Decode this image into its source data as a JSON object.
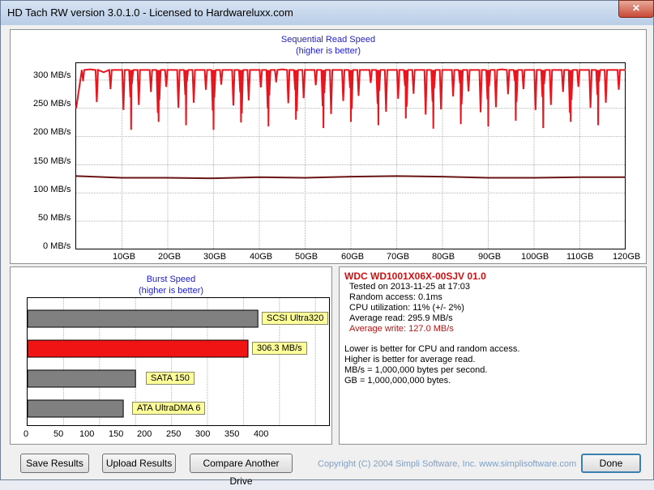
{
  "window": {
    "title": "HD Tach RW version 3.0.1.0 - Licensed to Hardwareluxx.com",
    "close_glyph": "✕"
  },
  "seq_chart": {
    "title": "Sequential Read Speed",
    "subtitle": "(higher is better)",
    "y_ticks": [
      "300 MB/s",
      "250 MB/s",
      "200 MB/s",
      "150 MB/s",
      "100 MB/s",
      "50 MB/s",
      "0 MB/s"
    ],
    "x_ticks": [
      "10GB",
      "20GB",
      "30GB",
      "40GB",
      "50GB",
      "60GB",
      "70GB",
      "80GB",
      "90GB",
      "100GB",
      "110GB",
      "120GB"
    ]
  },
  "burst_chart": {
    "title": "Burst Speed",
    "subtitle": "(higher is better)",
    "x_ticks": [
      "0",
      "50",
      "100",
      "150",
      "200",
      "250",
      "300",
      "350",
      "400"
    ]
  },
  "chart_data": [
    {
      "type": "line",
      "title": "Sequential Read Speed",
      "subtitle": "(higher is better)",
      "x_unit": "GB",
      "xlim": [
        0,
        120
      ],
      "ylim": [
        0,
        330
      ],
      "grid": true,
      "series": [
        {
          "color": "#e8141e",
          "baseline": 318,
          "dip_min": 210,
          "x": [
            0,
            3,
            6,
            9,
            12,
            15,
            18,
            21,
            24,
            27,
            30,
            33,
            36,
            39,
            42,
            45,
            48,
            51,
            54,
            57,
            60,
            63,
            66,
            69,
            72,
            75,
            78,
            81,
            84,
            87,
            90,
            93,
            96,
            99,
            102,
            105,
            108,
            111,
            114,
            117,
            120
          ],
          "y": [
            250,
            319,
            314,
            318,
            212,
            318,
            226,
            318,
            220,
            318,
            212,
            318,
            225,
            318,
            218,
            319,
            230,
            318,
            215,
            318,
            226,
            318,
            220,
            318,
            232,
            318,
            214,
            318,
            222,
            318,
            218,
            319,
            228,
            318,
            215,
            318,
            226,
            318,
            220,
            318,
            318
          ]
        },
        {
          "color": "#6b1414",
          "x": [
            0,
            10,
            20,
            30,
            40,
            50,
            60,
            70,
            80,
            90,
            100,
            110,
            120
          ],
          "y": [
            130,
            127,
            127,
            126,
            128,
            127,
            129,
            130,
            129,
            127,
            127,
            128,
            128
          ]
        }
      ]
    },
    {
      "type": "bar",
      "title": "Burst Speed",
      "subtitle": "(higher is better)",
      "xlim": [
        0,
        420
      ],
      "grid": true,
      "categories": [
        "SCSI Ultra320",
        "306.3 MB/s",
        "SATA 150",
        "ATA UltraDMA 6"
      ],
      "values": [
        320,
        306.3,
        150,
        133
      ],
      "colors": [
        "#808080",
        "#f01414",
        "#808080",
        "#808080"
      ]
    }
  ],
  "info": {
    "drive_title": "WDC WD1001X06X-00SJV 01.0",
    "tested_on": "Tested on 2013-11-25 at 17:03",
    "random_access": "Random access: 0.1ms",
    "cpu": "CPU utilization: 11% (+/- 2%)",
    "avg_read": "Average read: 295.9 MB/s",
    "avg_write": "Average write: 127.0 MB/s",
    "note1": "Lower is better for CPU and random access.",
    "note2": "Higher is better for average read.",
    "note3": "MB/s = 1,000,000 bytes per second.",
    "note4": "GB = 1,000,000,000 bytes.",
    "colors": {
      "drive_title": "#d01010",
      "avg_write": "#b41414"
    }
  },
  "buttons": {
    "save": "Save Results",
    "upload": "Upload Results",
    "compare": "Compare Another Drive",
    "done": "Done"
  },
  "copyright": "Copyright (C) 2004 Simpli Software, Inc. www.simplisoftware.com"
}
